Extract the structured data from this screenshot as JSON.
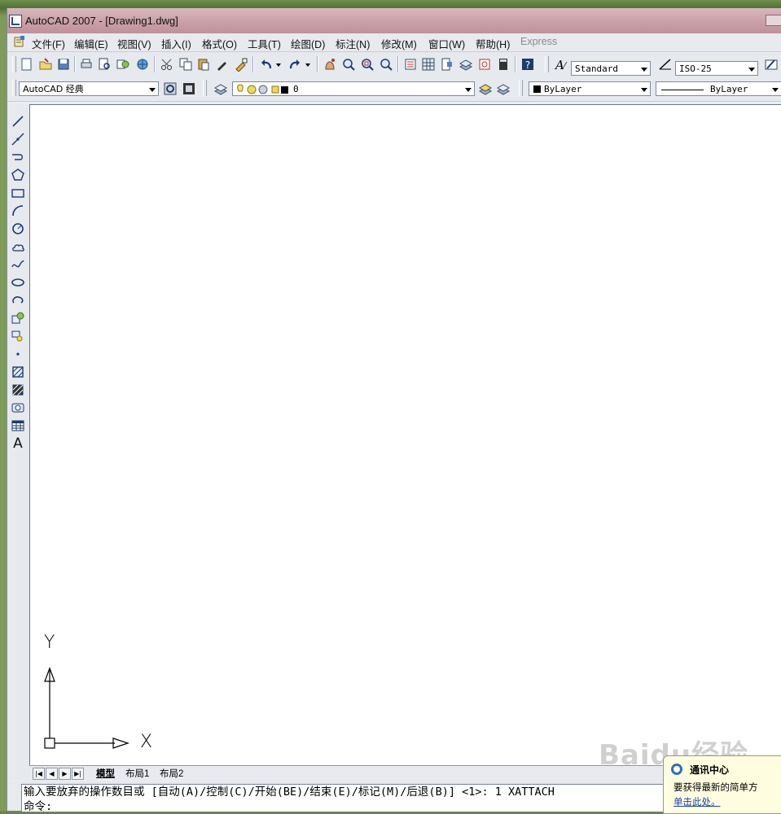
{
  "window": {
    "title": "AutoCAD 2007 - [Drawing1.dwg]"
  },
  "menu": {
    "items": [
      "文件(F)",
      "编辑(E)",
      "视图(V)",
      "插入(I)",
      "格式(O)",
      "工具(T)",
      "绘图(D)",
      "标注(N)",
      "修改(M)",
      "窗口(W)",
      "帮助(H)",
      "Express"
    ]
  },
  "toolbar_standard": {
    "text_style": "Standard",
    "dim_style": "ISO-25"
  },
  "toolbar_properties": {
    "workspace": "AutoCAD 经典",
    "layer": "0",
    "color": "ByLayer",
    "linetype": "ByLayer"
  },
  "draw_toolbar": {
    "text_tool": "A"
  },
  "ucs": {
    "x_label": "X",
    "y_label": "Y"
  },
  "tabs": [
    "模型",
    "布局1",
    "布局2"
  ],
  "command": {
    "line1": "输入要放弃的操作数目或 [自动(A)/控制(C)/开始(BE)/结束(E)/标记(M)/后退(B)] <1>: 1 XATTACH",
    "line2": "命令:"
  },
  "comm_center": {
    "title": "通讯中心",
    "body": "要获得最新的简单方",
    "link": "单击此处。"
  },
  "watermark": "Baidu经验",
  "colors": {
    "title_bar": "#caa0a8",
    "canvas_bg": "#ffffff",
    "toolbar_bg": "#e6e9ee",
    "link": "#1a3fb8"
  }
}
